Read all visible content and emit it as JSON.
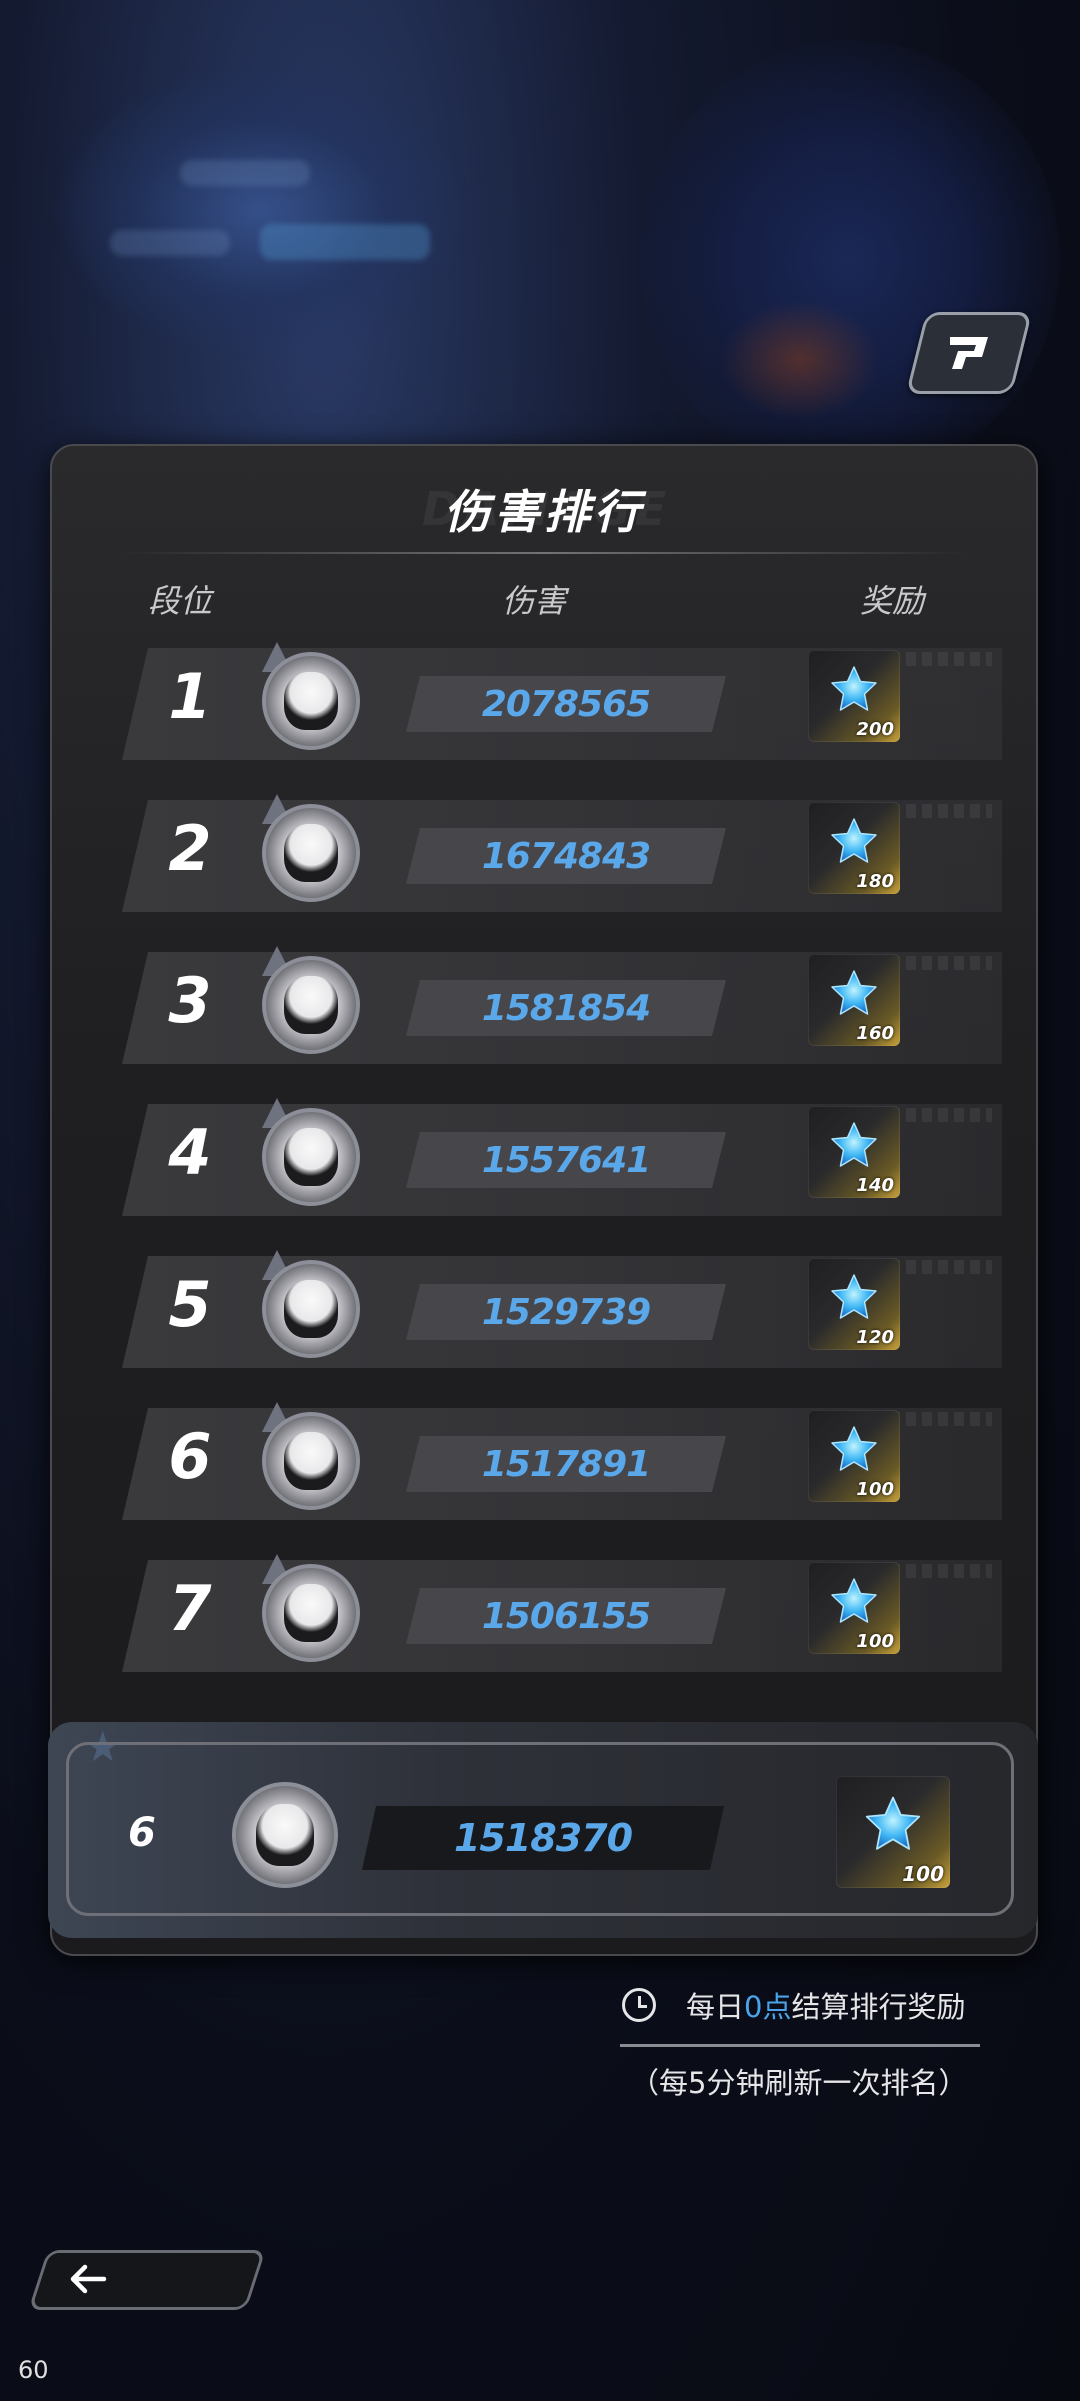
{
  "panel": {
    "title": "伤害排行",
    "col_rank": "段位",
    "col_damage": "伤害",
    "col_reward": "奖励"
  },
  "rows": [
    {
      "rank": "1",
      "damage": "2078565",
      "reward_qty": "200"
    },
    {
      "rank": "2",
      "damage": "1674843",
      "reward_qty": "180"
    },
    {
      "rank": "3",
      "damage": "1581854",
      "reward_qty": "160"
    },
    {
      "rank": "4",
      "damage": "1557641",
      "reward_qty": "140"
    },
    {
      "rank": "5",
      "damage": "1529739",
      "reward_qty": "120"
    },
    {
      "rank": "6",
      "damage": "1517891",
      "reward_qty": "100"
    },
    {
      "rank": "7",
      "damage": "1506155",
      "reward_qty": "100"
    }
  ],
  "self": {
    "rank": "6",
    "damage": "1518370",
    "reward_qty": "100"
  },
  "info": {
    "line1_prefix": "每日",
    "line1_highlight": "0点",
    "line1_suffix": "结算排行奖励",
    "line2": "（每5分钟刷新一次排名）"
  },
  "fps": "60",
  "icons": {
    "share": "share-icon",
    "reward": "blue-star-icon",
    "back": "back-arrow-icon",
    "clock": "clock-icon"
  },
  "colors": {
    "damage_text": "#5aa8ea",
    "highlight": "#4aa3ea"
  }
}
